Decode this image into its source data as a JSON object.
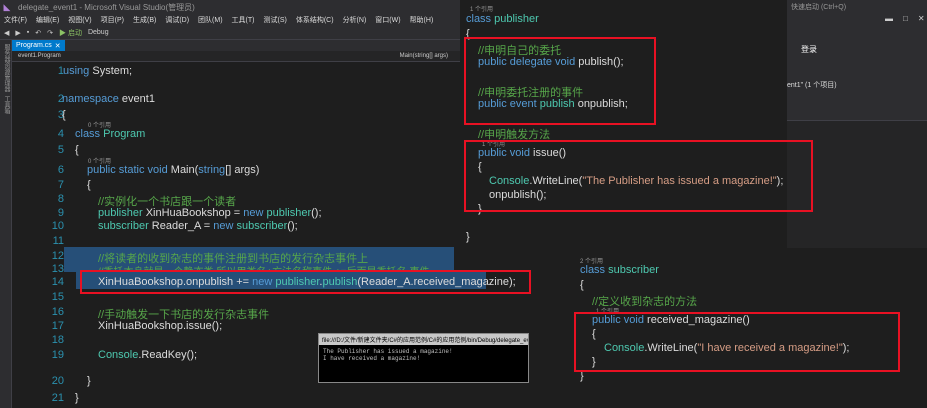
{
  "window": {
    "title": "delegate_event1 - Microsoft Visual Studio(管理员)",
    "quick_launch": "快速启动 (Ctrl+Q)",
    "controls": [
      "▬",
      "□",
      "✕"
    ]
  },
  "menu": [
    "文件(F)",
    "编辑(E)",
    "视图(V)",
    "项目(P)",
    "生成(B)",
    "调试(D)",
    "团队(M)",
    "工具(T)",
    "测试(S)",
    "体系结构(C)",
    "分析(N)",
    "窗口(W)",
    "帮助(H)"
  ],
  "toolbar": {
    "start": "▶ 启动",
    "config": "Debug",
    "platform": "登录"
  },
  "left_strip": [
    "服务器资源管理器",
    "工具箱"
  ],
  "tabs": [
    {
      "label": "Program.cs",
      "close": "✕"
    }
  ],
  "nav": {
    "left": "event1.Program",
    "right": "Main(string[] args)"
  },
  "editor": {
    "line_numbers": [
      "1",
      "2",
      "3",
      "4",
      "5",
      "6",
      "7",
      "8",
      "9",
      "10",
      "11",
      "12",
      "13",
      "14",
      "15",
      "16",
      "17",
      "18",
      "19",
      "20",
      "21"
    ],
    "lines": {
      "l1": {
        "a": "using",
        "b": " System;"
      },
      "l3": {
        "a": "namespace",
        "b": " event1"
      },
      "l4": "{",
      "ref5": "0 个引用",
      "l5": {
        "a": "class",
        "b": " ",
        "c": "Program"
      },
      "l6": "{",
      "ref7": "0 个引用",
      "l7": {
        "a": "public static void",
        "b": " Main(",
        "c": "string",
        "d": "[] args)"
      },
      "l8": "{",
      "l9": "//实例化一个书店跟一个读者",
      "l10": {
        "a": "publisher",
        "b": " XinHuaBookshop = ",
        "c": "new",
        "d": " ",
        "e": "publisher",
        "f": "();"
      },
      "l11": {
        "a": "subscriber",
        "b": " Reader_A = ",
        "c": "new",
        "d": " ",
        "e": "subscriber",
        "f": "();"
      },
      "l13": "//将读者的收到杂志的事件注册到书店的发行杂志事件上",
      "l14": "//委托本身就是一个静态类,所以用类名+方法名称事件 +=后面是委托名 事件",
      "l15": {
        "a": "XinHuaBookshop.onpublish += ",
        "b": "new",
        "c": " ",
        "d": "publisher",
        "e": ".",
        "f": "publish",
        "g": "(Reader_A.received_magazine);"
      },
      "l17": "//手动触发一下书店的发行杂志事件",
      "l18": "XinHuaBookshop.issue();",
      "l20": {
        "a": "Console",
        "b": ".ReadKey();"
      },
      "l21": "}",
      "l22": "}"
    }
  },
  "publisher_panel": {
    "ref": "1 个引用",
    "class_kw": "class",
    "class_name": "publisher",
    "open": "{",
    "c1": "//申明自己的委托",
    "d1": {
      "a": "public delegate void",
      "b": " publish();"
    },
    "c2": "//申明委托注册的事件",
    "d2": {
      "a": "public event",
      "b": " ",
      "c": "publish",
      "d": " onpublish;"
    },
    "c3": "//申明触发方法",
    "ref2": "1 个引用",
    "m1": {
      "a": "public void",
      "b": " issue()"
    },
    "m2": "{",
    "m3": {
      "a": "Console",
      "b": ".WriteLine(",
      "c": "\"The Publisher has issued a magazine!\"",
      "d": ");"
    },
    "m4": "onpublish();",
    "m5": "}",
    "close": "}"
  },
  "subscriber_panel": {
    "ref": "2 个引用",
    "class_kw": "class",
    "class_name": "subscriber",
    "open": "{",
    "c1": "//定义收到杂志的方法",
    "ref2": "1 个引用",
    "m1": {
      "a": "public void",
      "b": " received_magazine()"
    },
    "m2": "{",
    "m3": {
      "a": "Console",
      "b": ".WriteLine(",
      "c": "\"I have received a magazine!\"",
      "d": ");"
    },
    "m4": "}",
    "close": "}"
  },
  "right_side": {
    "text1": "ent1\" (1 个项目)",
    "label": "登录"
  },
  "console": {
    "title": "file:///D:/文件/新建文件夹/C#的应用范例/C#的应用范例/bin/Debug/delegate_event1.EXE",
    "out1": "The Publisher has issued a magazine!",
    "out2": "I have received a magazine!"
  },
  "colors": {
    "keyword": "#569cd6",
    "type": "#4ec9b0",
    "comment": "#57a64a",
    "string": "#d69d85",
    "highlight_box": "#e81123"
  }
}
